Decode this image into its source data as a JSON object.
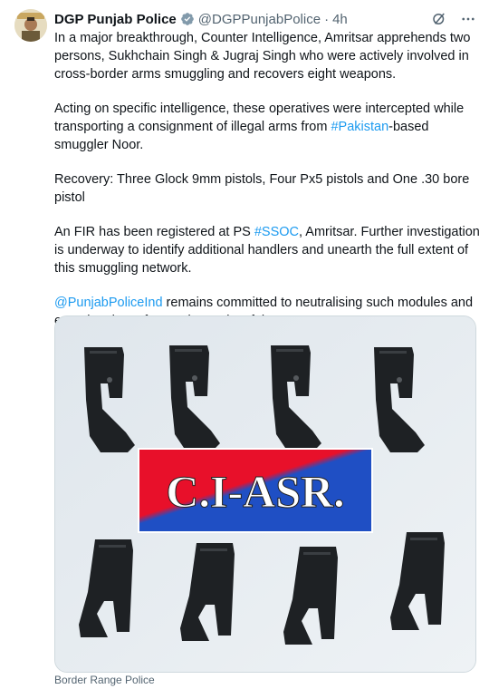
{
  "author": {
    "name": "DGP Punjab Police",
    "handle": "@DGPPunjabPolice",
    "separator": "·",
    "time": "4h"
  },
  "icons": {
    "verified": "verified-badge-icon",
    "grok": "grok-icon",
    "more": "more-options-icon"
  },
  "tweet": {
    "p1": "In a major breakthrough, Counter Intelligence, Amritsar apprehends two persons, Sukhchain Singh & Jugraj Singh who were actively involved in cross-border arms smuggling and recovers eight weapons.",
    "p2_before": "Acting on specific intelligence, these operatives were intercepted while transporting a consignment of illegal arms from ",
    "p2_link": "#Pakistan",
    "p2_after": "-based smuggler Noor.",
    "p3": "Recovery: Three Glock 9mm pistols, Four Px5 pistols and One .30 bore pistol",
    "p4_before": "An FIR has been registered at PS ",
    "p4_link": "#SSOC",
    "p4_after": ", Amritsar. Further investigation is underway to identify additional handlers and unearth the full extent of this smuggling network.",
    "p5_link": "@PunjabPoliceInd",
    "p5_after": " remains committed to neutralising such modules and ensuring the safety and security of the state."
  },
  "media": {
    "banner_text": "C.I-ASR.",
    "pistol_count": 8
  },
  "caption": "Border Range Police",
  "colors": {
    "link": "#1d9bf0",
    "muted": "#536471",
    "banner_red": "#e8102a",
    "banner_blue": "#1f4fc4"
  }
}
